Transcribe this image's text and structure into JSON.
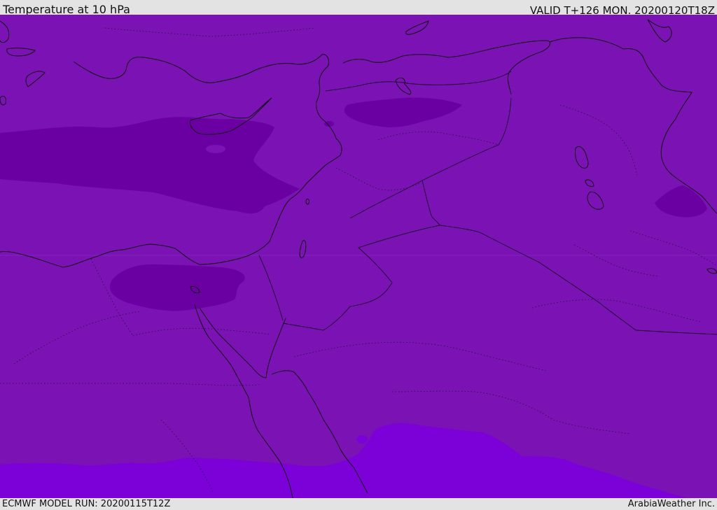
{
  "header": {
    "title": "Temperature at 10 hPa",
    "valid": "VALID T+126 MON. 20200120T18Z"
  },
  "footer": {
    "model_run": "ECMWF MODEL RUN: 20200115T12Z",
    "credit": "ArabiaWeather Inc."
  },
  "map": {
    "colors": {
      "base": "#7a12b4",
      "cold": "#6a00a2",
      "warm": "#7c00d8",
      "coast": "#111111",
      "border": "#1a0a2a"
    }
  }
}
